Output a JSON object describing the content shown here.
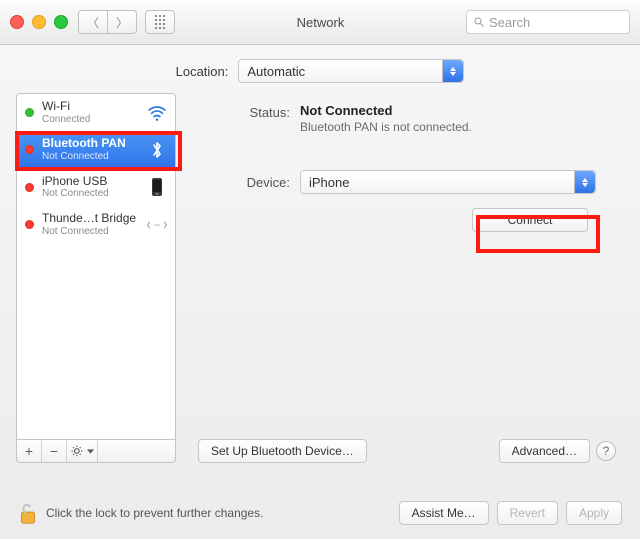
{
  "title": "Network",
  "search_placeholder": "Search",
  "location": {
    "label": "Location:",
    "value": "Automatic"
  },
  "sidebar": {
    "items": [
      {
        "name": "Wi-Fi",
        "status": "Connected",
        "dot": "green"
      },
      {
        "name": "Bluetooth PAN",
        "status": "Not Connected",
        "dot": "red"
      },
      {
        "name": "iPhone USB",
        "status": "Not Connected",
        "dot": "red"
      },
      {
        "name": "Thunde…t Bridge",
        "status": "Not Connected",
        "dot": "red"
      }
    ],
    "foot": {
      "add": "+",
      "remove": "−"
    }
  },
  "status": {
    "label": "Status:",
    "value": "Not Connected",
    "sub": "Bluetooth PAN is not connected."
  },
  "device": {
    "label": "Device:",
    "value": "iPhone"
  },
  "buttons": {
    "connect": "Connect",
    "setup": "Set Up Bluetooth Device…",
    "advanced": "Advanced…",
    "assist": "Assist Me…",
    "revert": "Revert",
    "apply": "Apply"
  },
  "lock_msg": "Click the lock to prevent further changes.",
  "help": "?"
}
